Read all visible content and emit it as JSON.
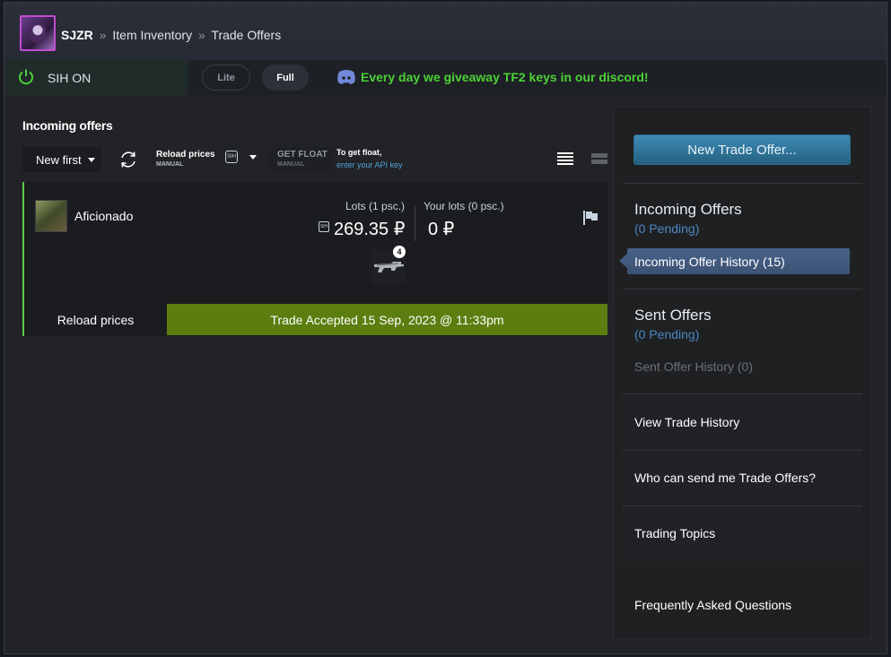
{
  "breadcrumb": {
    "user": "SJZR",
    "sep": "»",
    "inventory": "Item Inventory",
    "page": "Trade Offers"
  },
  "sih": {
    "status": "SIH ON",
    "mode_lite": "Lite",
    "mode_full": "Full",
    "promo": "Every day we giveaway TF2 keys in our discord!",
    "accent": "#4cd137"
  },
  "main": {
    "title": "Incoming offers",
    "sort_label": "New first",
    "reload_label": "Reload prices",
    "reload_sub": "MANUAL",
    "currency_badge": "SIH",
    "float_label": "GET FLOAT",
    "float_sub": "MANUAL",
    "float_hint": "To get float,",
    "float_link": "enter your API key"
  },
  "offer": {
    "partner": "Aficionado",
    "lots_label": "Lots (1 psc.)",
    "lots_price": "269.35 ₽",
    "lots_badge": "SIH",
    "your_lots_label": "Your lots (0 psc.)",
    "your_lots_price": "0 ₽",
    "item_count": "4",
    "reload_button": "Reload prices",
    "status": "Trade Accepted 15 Sep, 2023 @ 11:33pm",
    "status_color": "#5c7e10"
  },
  "sidebar": {
    "new_offer": "New Trade Offer...",
    "incoming_title": "Incoming Offers",
    "incoming_pending": "(0 Pending)",
    "incoming_history": "Incoming Offer History (15)",
    "sent_title": "Sent Offers",
    "sent_pending": "(0 Pending)",
    "sent_history": "Sent Offer History (0)",
    "view_history": "View Trade History",
    "who_can_send": "Who can send me Trade Offers?",
    "trading_topics": "Trading Topics",
    "faq": "Frequently Asked Questions"
  }
}
